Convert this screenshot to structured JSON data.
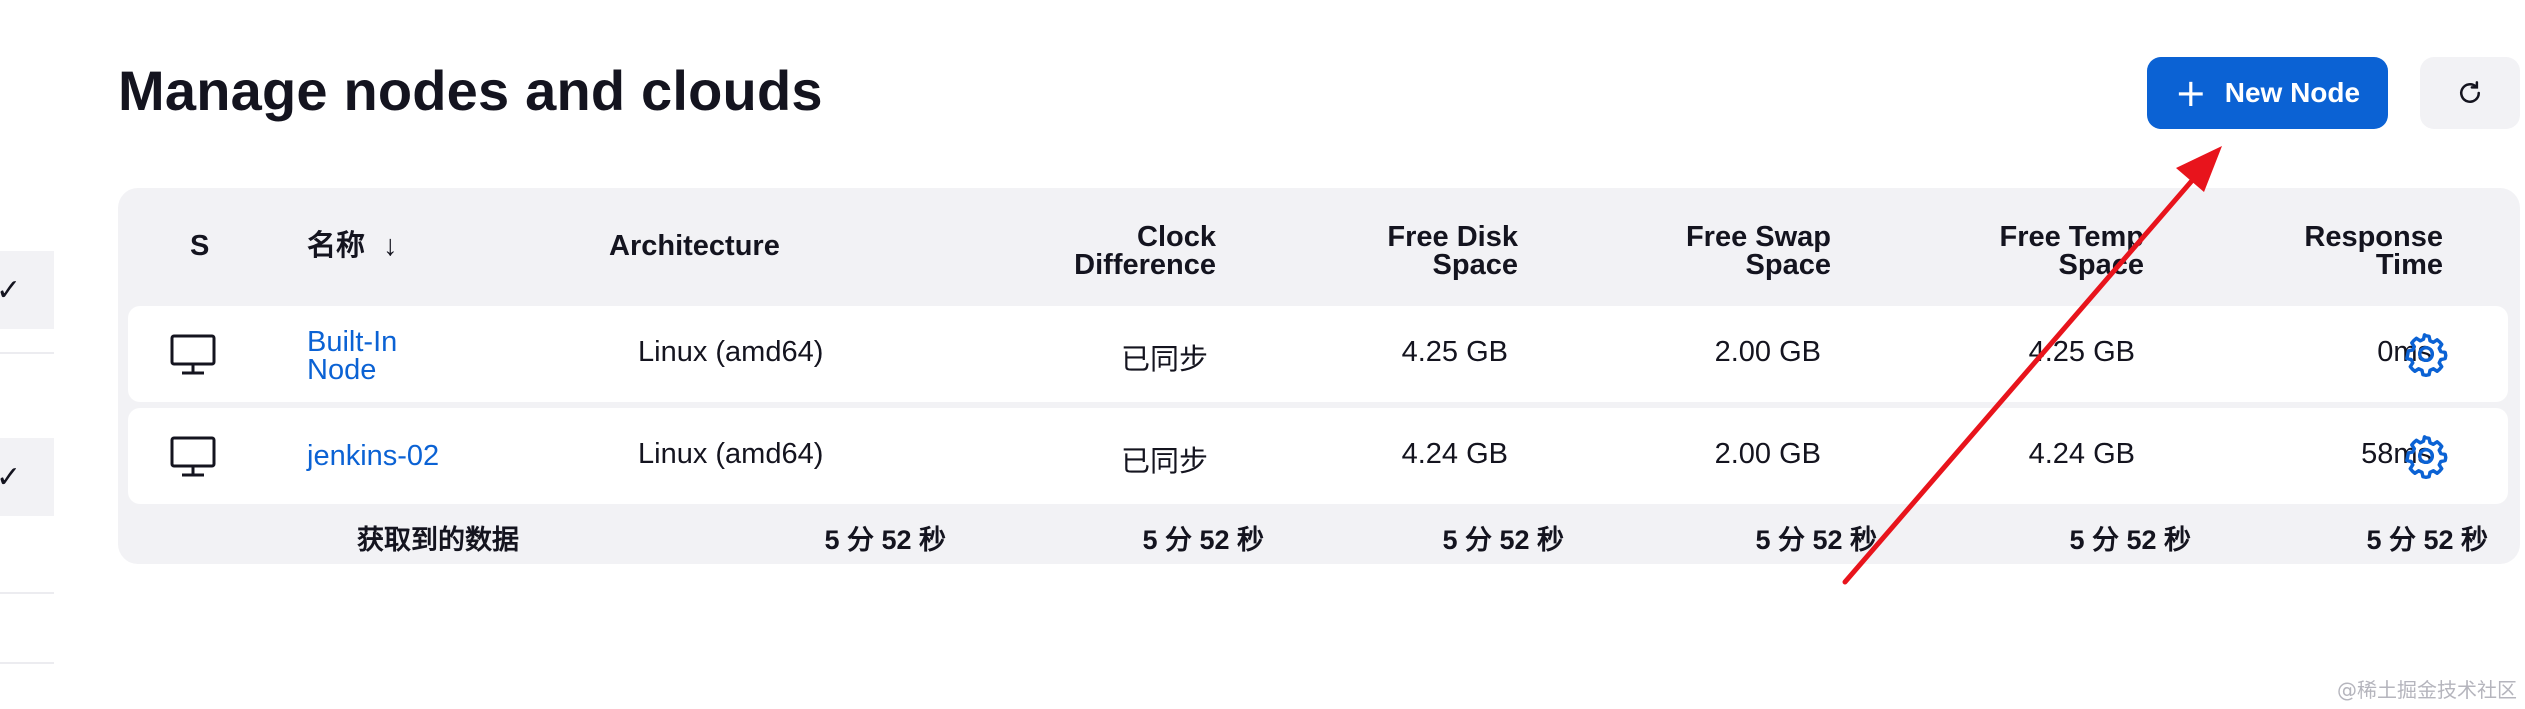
{
  "page": {
    "title": "Manage nodes and clouds",
    "new_node_label": "New Node"
  },
  "table": {
    "headers": {
      "status": "S",
      "name": "名称",
      "sort_indicator": "↓",
      "architecture": "Architecture",
      "clock_line1": "Clock",
      "clock_line2": "Difference",
      "disk_line1": "Free Disk",
      "disk_line2": "Space",
      "swap_line1": "Free Swap",
      "swap_line2": "Space",
      "temp_line1": "Free Temp",
      "temp_line2": "Space",
      "resp_line1": "Response",
      "resp_line2": "Time"
    },
    "rows": [
      {
        "name_line1": "Built-In",
        "name_line2": "Node",
        "architecture": "Linux (amd64)",
        "clock": "已同步",
        "disk": "4.25 GB",
        "swap": "2.00 GB",
        "temp": "4.25 GB",
        "response": "0ms"
      },
      {
        "name_line1": "jenkins-02",
        "name_line2": "",
        "architecture": "Linux (amd64)",
        "clock": "已同步",
        "disk": "4.24 GB",
        "swap": "2.00 GB",
        "temp": "4.24 GB",
        "response": "58ms"
      }
    ],
    "footer": {
      "label": "获取到的数据",
      "architecture": "5 分 52 秒",
      "clock": "5 分 52 秒",
      "disk": "5 分 52 秒",
      "swap": "5 分 52 秒",
      "temp": "5 分 52 秒",
      "response": "5 分 52 秒"
    }
  },
  "watermark": "@稀土掘金技术社区",
  "colors": {
    "accent": "#0b62d4",
    "annotation_arrow": "#e8141c"
  },
  "icons": {
    "status": "computer-monitor-icon",
    "configure": "gear-icon",
    "refresh": "refresh-icon",
    "add": "plus-icon"
  }
}
